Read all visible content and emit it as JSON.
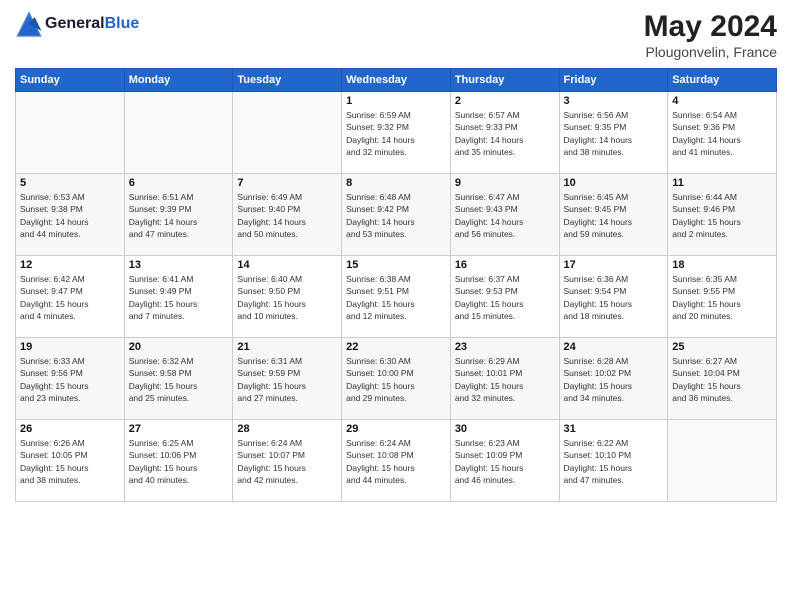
{
  "header": {
    "logo_line1": "General",
    "logo_line2": "Blue",
    "month": "May 2024",
    "location": "Plougonvelin, France"
  },
  "weekdays": [
    "Sunday",
    "Monday",
    "Tuesday",
    "Wednesday",
    "Thursday",
    "Friday",
    "Saturday"
  ],
  "weeks": [
    [
      {
        "day": "",
        "info": ""
      },
      {
        "day": "",
        "info": ""
      },
      {
        "day": "",
        "info": ""
      },
      {
        "day": "1",
        "info": "Sunrise: 6:59 AM\nSunset: 9:32 PM\nDaylight: 14 hours\nand 32 minutes."
      },
      {
        "day": "2",
        "info": "Sunrise: 6:57 AM\nSunset: 9:33 PM\nDaylight: 14 hours\nand 35 minutes."
      },
      {
        "day": "3",
        "info": "Sunrise: 6:56 AM\nSunset: 9:35 PM\nDaylight: 14 hours\nand 38 minutes."
      },
      {
        "day": "4",
        "info": "Sunrise: 6:54 AM\nSunset: 9:36 PM\nDaylight: 14 hours\nand 41 minutes."
      }
    ],
    [
      {
        "day": "5",
        "info": "Sunrise: 6:53 AM\nSunset: 9:38 PM\nDaylight: 14 hours\nand 44 minutes."
      },
      {
        "day": "6",
        "info": "Sunrise: 6:51 AM\nSunset: 9:39 PM\nDaylight: 14 hours\nand 47 minutes."
      },
      {
        "day": "7",
        "info": "Sunrise: 6:49 AM\nSunset: 9:40 PM\nDaylight: 14 hours\nand 50 minutes."
      },
      {
        "day": "8",
        "info": "Sunrise: 6:48 AM\nSunset: 9:42 PM\nDaylight: 14 hours\nand 53 minutes."
      },
      {
        "day": "9",
        "info": "Sunrise: 6:47 AM\nSunset: 9:43 PM\nDaylight: 14 hours\nand 56 minutes."
      },
      {
        "day": "10",
        "info": "Sunrise: 6:45 AM\nSunset: 9:45 PM\nDaylight: 14 hours\nand 59 minutes."
      },
      {
        "day": "11",
        "info": "Sunrise: 6:44 AM\nSunset: 9:46 PM\nDaylight: 15 hours\nand 2 minutes."
      }
    ],
    [
      {
        "day": "12",
        "info": "Sunrise: 6:42 AM\nSunset: 9:47 PM\nDaylight: 15 hours\nand 4 minutes."
      },
      {
        "day": "13",
        "info": "Sunrise: 6:41 AM\nSunset: 9:49 PM\nDaylight: 15 hours\nand 7 minutes."
      },
      {
        "day": "14",
        "info": "Sunrise: 6:40 AM\nSunset: 9:50 PM\nDaylight: 15 hours\nand 10 minutes."
      },
      {
        "day": "15",
        "info": "Sunrise: 6:38 AM\nSunset: 9:51 PM\nDaylight: 15 hours\nand 12 minutes."
      },
      {
        "day": "16",
        "info": "Sunrise: 6:37 AM\nSunset: 9:53 PM\nDaylight: 15 hours\nand 15 minutes."
      },
      {
        "day": "17",
        "info": "Sunrise: 6:36 AM\nSunset: 9:54 PM\nDaylight: 15 hours\nand 18 minutes."
      },
      {
        "day": "18",
        "info": "Sunrise: 6:35 AM\nSunset: 9:55 PM\nDaylight: 15 hours\nand 20 minutes."
      }
    ],
    [
      {
        "day": "19",
        "info": "Sunrise: 6:33 AM\nSunset: 9:56 PM\nDaylight: 15 hours\nand 23 minutes."
      },
      {
        "day": "20",
        "info": "Sunrise: 6:32 AM\nSunset: 9:58 PM\nDaylight: 15 hours\nand 25 minutes."
      },
      {
        "day": "21",
        "info": "Sunrise: 6:31 AM\nSunset: 9:59 PM\nDaylight: 15 hours\nand 27 minutes."
      },
      {
        "day": "22",
        "info": "Sunrise: 6:30 AM\nSunset: 10:00 PM\nDaylight: 15 hours\nand 29 minutes."
      },
      {
        "day": "23",
        "info": "Sunrise: 6:29 AM\nSunset: 10:01 PM\nDaylight: 15 hours\nand 32 minutes."
      },
      {
        "day": "24",
        "info": "Sunrise: 6:28 AM\nSunset: 10:02 PM\nDaylight: 15 hours\nand 34 minutes."
      },
      {
        "day": "25",
        "info": "Sunrise: 6:27 AM\nSunset: 10:04 PM\nDaylight: 15 hours\nand 36 minutes."
      }
    ],
    [
      {
        "day": "26",
        "info": "Sunrise: 6:26 AM\nSunset: 10:05 PM\nDaylight: 15 hours\nand 38 minutes."
      },
      {
        "day": "27",
        "info": "Sunrise: 6:25 AM\nSunset: 10:06 PM\nDaylight: 15 hours\nand 40 minutes."
      },
      {
        "day": "28",
        "info": "Sunrise: 6:24 AM\nSunset: 10:07 PM\nDaylight: 15 hours\nand 42 minutes."
      },
      {
        "day": "29",
        "info": "Sunrise: 6:24 AM\nSunset: 10:08 PM\nDaylight: 15 hours\nand 44 minutes."
      },
      {
        "day": "30",
        "info": "Sunrise: 6:23 AM\nSunset: 10:09 PM\nDaylight: 15 hours\nand 46 minutes."
      },
      {
        "day": "31",
        "info": "Sunrise: 6:22 AM\nSunset: 10:10 PM\nDaylight: 15 hours\nand 47 minutes."
      },
      {
        "day": "",
        "info": ""
      }
    ]
  ]
}
